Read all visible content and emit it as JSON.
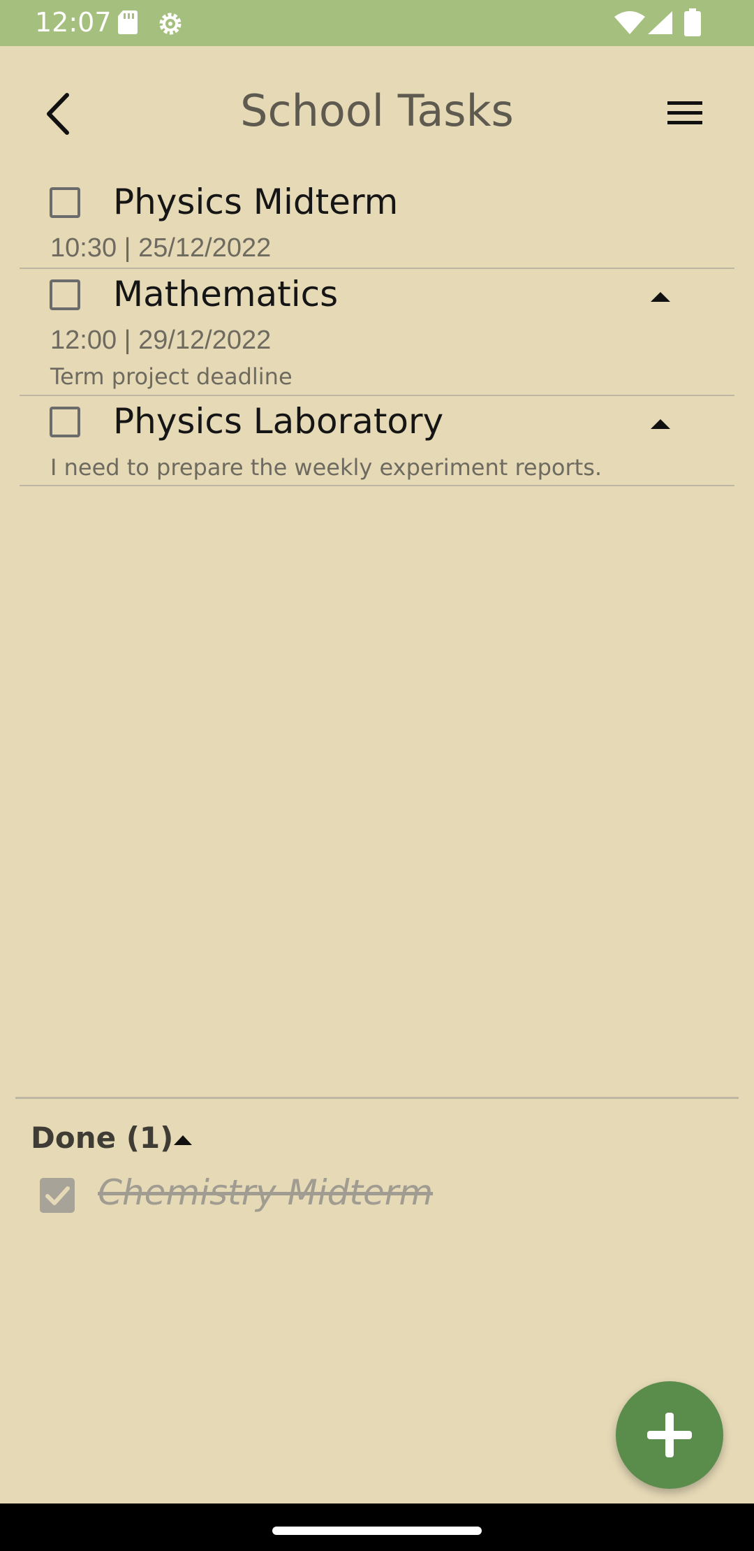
{
  "status_bar": {
    "time": "12:07",
    "icons": [
      "sd-card-icon",
      "settings-icon",
      "wifi-icon",
      "signal-icon",
      "battery-icon"
    ]
  },
  "app_bar": {
    "title": "School Tasks",
    "back_icon": "back-arrow-icon",
    "menu_icon": "menu-icon"
  },
  "tasks": [
    {
      "name": "Physics Midterm",
      "datetime": "10:30 | 25/12/2022",
      "description": "",
      "checked": false,
      "expandable": false
    },
    {
      "name": "Mathematics",
      "datetime": "12:00 | 29/12/2022",
      "description": "Term project deadline",
      "checked": false,
      "expandable": true
    },
    {
      "name": "Physics Laboratory",
      "datetime": "",
      "description": "I need to prepare the weekly experiment reports.",
      "checked": false,
      "expandable": true
    }
  ],
  "done": {
    "header": "Done (1)",
    "items": [
      {
        "name": "Chemistry Midterm",
        "checked": true
      }
    ]
  },
  "fab": {
    "icon": "plus-icon"
  },
  "colors": {
    "background": "#e5d9b6",
    "status_bar": "#a4bf7e",
    "fab": "#5a8d4c",
    "divider": "#bdb6a2"
  }
}
